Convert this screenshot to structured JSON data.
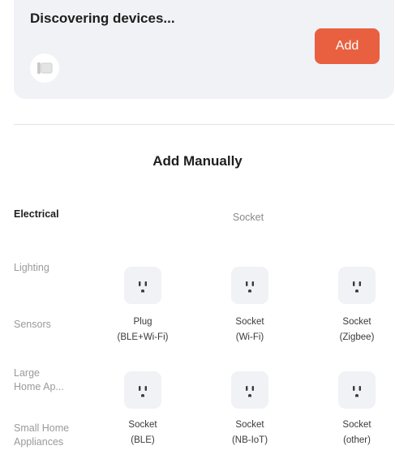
{
  "discovery": {
    "title": "Discovering devices...",
    "add_label": "Add"
  },
  "manual": {
    "title": "Add Manually"
  },
  "categories": [
    {
      "label": "Electrical",
      "active": true
    },
    {
      "label": "Lighting",
      "active": false
    },
    {
      "label": "Sensors",
      "active": false
    },
    {
      "label": "Large\nHome Ap...",
      "active": false
    },
    {
      "label": "Small Home\nAppliances",
      "active": false
    }
  ],
  "group": {
    "title": "Socket",
    "devices": [
      {
        "name": "Plug",
        "variant": "(BLE+Wi-Fi)",
        "icon": "socket-icon"
      },
      {
        "name": "Socket",
        "variant": "(Wi-Fi)",
        "icon": "socket-icon"
      },
      {
        "name": "Socket",
        "variant": "(Zigbee)",
        "icon": "socket-icon"
      },
      {
        "name": "Socket",
        "variant": "(BLE)",
        "icon": "socket-icon"
      },
      {
        "name": "Socket",
        "variant": "(NB-IoT)",
        "icon": "socket-icon"
      },
      {
        "name": "Socket",
        "variant": "(other)",
        "icon": "socket-icon"
      }
    ]
  },
  "colors": {
    "accent": "#e8603f",
    "card_background": "#f1f2f6",
    "icon_tile": "#f1f2f5"
  }
}
